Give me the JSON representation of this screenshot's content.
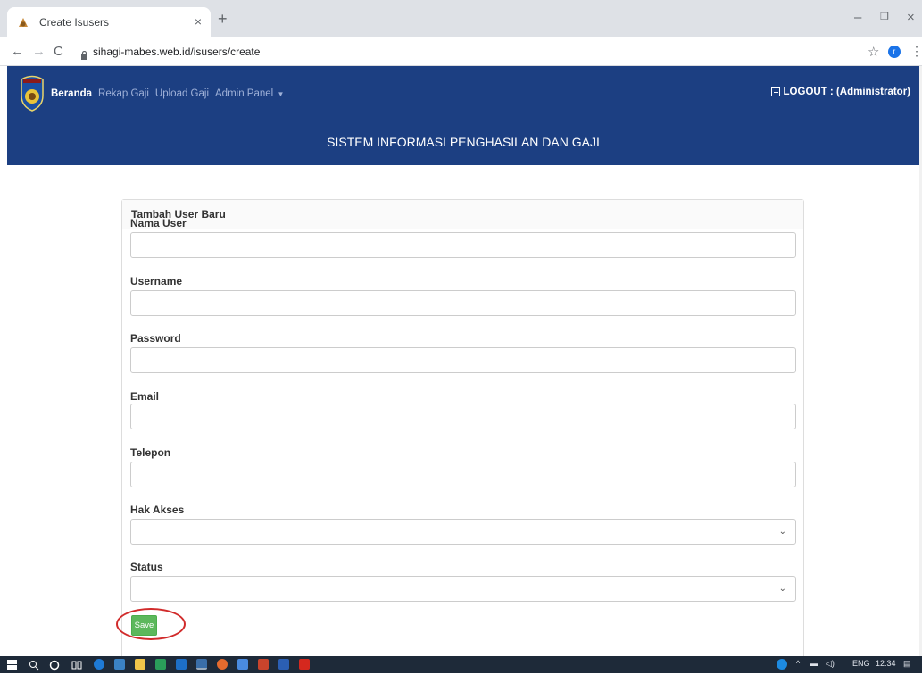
{
  "browser": {
    "tab_title": "Create Isusers",
    "tab_close": "×",
    "new_tab": "+",
    "url": "sihagi-mabes.web.id/isusers/create",
    "profile_initial": "r",
    "window_controls": {
      "minimize": "–",
      "maximize": "❐",
      "close": "×"
    }
  },
  "header": {
    "nav": [
      {
        "label": "Beranda",
        "active": true
      },
      {
        "label": "Rekap Gaji",
        "active": false
      },
      {
        "label": "Upload Gaji",
        "active": false
      },
      {
        "label": "Admin Panel",
        "active": false,
        "dropdown": true
      }
    ],
    "logout": "LOGOUT : (Administrator)",
    "title": "SISTEM INFORMASI PENGHASILAN DAN GAJI",
    "color": "#1c3f82"
  },
  "form": {
    "panel_title": "Tambah User Baru",
    "fields": {
      "nama_user": {
        "label": "Nama User",
        "value": ""
      },
      "username": {
        "label": "Username",
        "value": ""
      },
      "password": {
        "label": "Password",
        "value": ""
      },
      "email": {
        "label": "Email",
        "value": ""
      },
      "telepon": {
        "label": "Telepon",
        "value": ""
      },
      "hak_akses": {
        "label": "Hak Akses",
        "value": ""
      },
      "status": {
        "label": "Status",
        "value": ""
      }
    },
    "save_label": "Save",
    "save_color": "#5cb85c"
  },
  "taskbar": {
    "language": "ENG",
    "clock": "12.34"
  }
}
